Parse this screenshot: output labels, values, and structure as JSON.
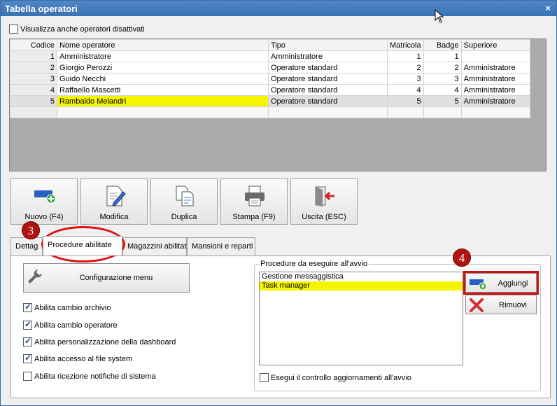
{
  "window": {
    "title": "Tabella operatori",
    "close_glyph": "×"
  },
  "show_disabled": {
    "label": "Visualizza anche operatori disattivati",
    "checked": false
  },
  "grid": {
    "headers": [
      "Codice",
      "Nome operatore",
      "Tipo",
      "Matricola",
      "Badge",
      "Superiore"
    ],
    "rows": [
      [
        "1",
        "Amministratore",
        "Amministratore",
        "1",
        "1",
        ""
      ],
      [
        "2",
        "Giorgio Perozzi",
        "Operatore standard",
        "2",
        "2",
        "Amministratore"
      ],
      [
        "3",
        "Guido Necchi",
        "Operatore standard",
        "3",
        "3",
        "Amministratore"
      ],
      [
        "4",
        "Raffaello Mascetti",
        "Operatore standard",
        "4",
        "4",
        "Amministratore"
      ],
      [
        "5",
        "Rambaldo Melandri",
        "Operatore standard",
        "5",
        "5",
        "Amministratore"
      ]
    ]
  },
  "toolbar": {
    "new_label": "Nuovo (F4)",
    "edit_label": "Modifica",
    "duplicate_label": "Duplica",
    "print_label": "Stampa (F9)",
    "exit_label": "Uscita (ESC)"
  },
  "tabs": [
    "Dettag",
    "Procedure abilitate",
    "Magazzini abilitati",
    "Mansioni e reparti"
  ],
  "active_tab": "Procedure abilitate",
  "config_menu_label": "Configurazione menu",
  "options": [
    {
      "label": "Abilita cambio archivio",
      "checked": true
    },
    {
      "label": "Abilita cambio operatore",
      "checked": true
    },
    {
      "label": "Abilita personalizzazione della dashboard",
      "checked": true
    },
    {
      "label": "Abilita accesso al file system",
      "checked": true
    },
    {
      "label": "Abilita ricezione notifiche di sistema",
      "checked": false
    }
  ],
  "startup": {
    "legend": "Procedure da eseguire all'avvio",
    "items": [
      "Gestione messaggistica",
      "Task manager"
    ],
    "selected": "Task manager",
    "check_updates": {
      "label": "Esegui il controllo aggiornamenti all'avvio",
      "checked": false
    },
    "add_label": "Aggiungi",
    "remove_label": "Rimuovi"
  },
  "annotations": {
    "step3": "3",
    "step4": "4",
    "color": "#d01010"
  }
}
